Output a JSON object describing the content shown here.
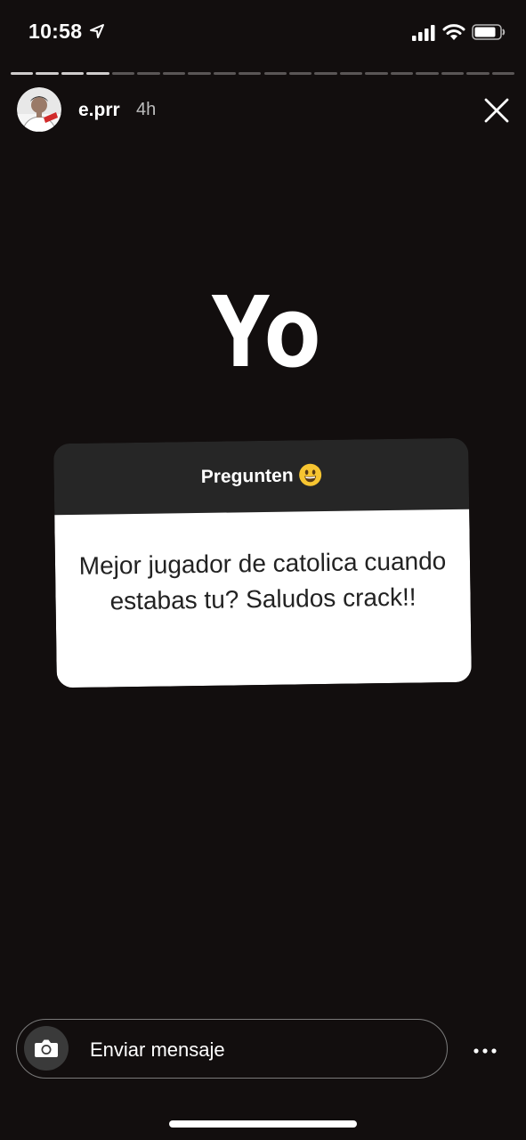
{
  "status_bar": {
    "time": "10:58",
    "icons": [
      "location-arrow-icon",
      "cellular-signal-icon",
      "wifi-icon",
      "battery-icon"
    ]
  },
  "progress": {
    "total_segments": 20,
    "viewed_segments": 4
  },
  "story_header": {
    "username": "e.prr",
    "time_ago": "4h",
    "avatar_icon": "profile-photo",
    "close_icon": "close-icon"
  },
  "story": {
    "overlay_text": "Yo",
    "question_sticker": {
      "title": "Pregunten",
      "title_emoji": "smiling-face-emoji",
      "answer": "Mejor jugador de catolica cuando estabas tu? Saludos crack!!"
    }
  },
  "message_bar": {
    "placeholder": "Enviar mensaje",
    "camera_icon": "camera-icon",
    "more_icon": "more-options-icon"
  },
  "colors": {
    "background": "#120e0e",
    "sticker_header": "#262626",
    "sticker_body": "#ffffff",
    "progress_viewed": "#cfcccc",
    "progress_unviewed": "#5a5656"
  }
}
